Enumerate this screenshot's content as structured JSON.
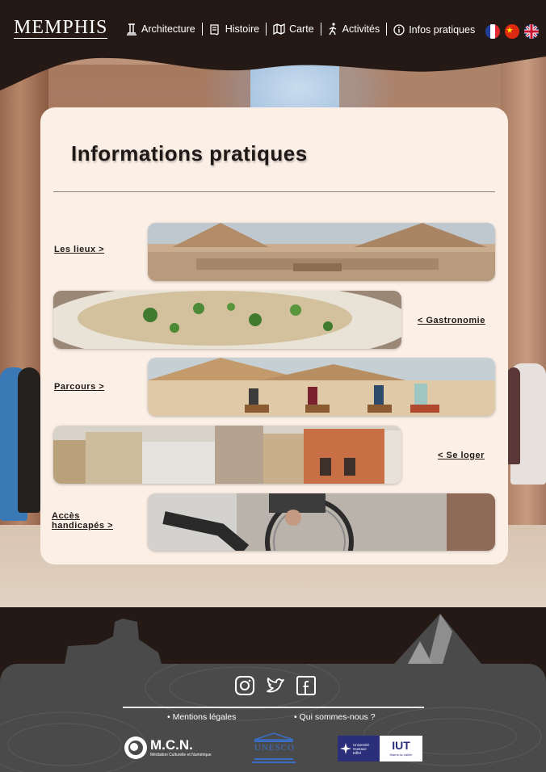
{
  "brand": {
    "name": "MEMPHIS"
  },
  "nav": {
    "items": [
      {
        "label": "Architecture",
        "icon": "column-icon"
      },
      {
        "label": "Histoire",
        "icon": "scroll-icon"
      },
      {
        "label": "Carte",
        "icon": "map-icon"
      },
      {
        "label": "Activités",
        "icon": "walking-icon"
      },
      {
        "label": "Infos pratiques",
        "icon": "info-icon"
      }
    ]
  },
  "languages": [
    "fr",
    "zh",
    "en"
  ],
  "page": {
    "title": "Informations pratiques",
    "sections": [
      {
        "label": "Les lieux  >",
        "image": "pyramids-and-sphinx"
      },
      {
        "label": "< Gastronomie",
        "image": "egyptian-dish"
      },
      {
        "label": "Parcours  >",
        "image": "camel-ride-pyramids"
      },
      {
        "label": "< Se loger",
        "image": "cairo-buildings"
      },
      {
        "label_line1": "Accès",
        "label_line2": "handicapés  >",
        "image": "wheelchair"
      }
    ]
  },
  "footer": {
    "links": [
      "Mentions légales",
      "Qui sommes-nous ?"
    ],
    "social": [
      "instagram-icon",
      "twitter-icon",
      "facebook-icon"
    ],
    "partners": {
      "mcn_name": "M.C.N.",
      "mcn_sub": "Médiation Culturelle et Numérique",
      "unesco": "UNESCO",
      "ugeuniv_line1": "Université",
      "ugeuniv_line2": "Gustave",
      "ugeuniv_line3": "Eiffel",
      "iut": "IUT",
      "iut_sub": "Marne-la-Vallée"
    }
  }
}
